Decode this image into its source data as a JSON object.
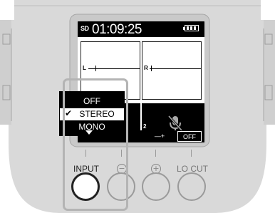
{
  "screen": {
    "storage_badge": "SD",
    "timecode": "01:09:25",
    "channel_left": "L",
    "channel_right": "R",
    "channel_2": "2",
    "mic_icon": "mic-muted-icon",
    "soft_keys": [
      "—+",
      "OFF"
    ]
  },
  "input_menu": {
    "options": [
      "OFF",
      "STEREO",
      "MONO"
    ],
    "selected": "STEREO",
    "check_mark": "✔"
  },
  "controls": {
    "input_label": "INPUT",
    "minus_symbol": "−",
    "plus_symbol": "+",
    "locut_label": "LO CUT"
  },
  "colors": {
    "body": "#d9d9d9",
    "highlight": "#b4b4b4",
    "screen_bg": "#000000"
  }
}
